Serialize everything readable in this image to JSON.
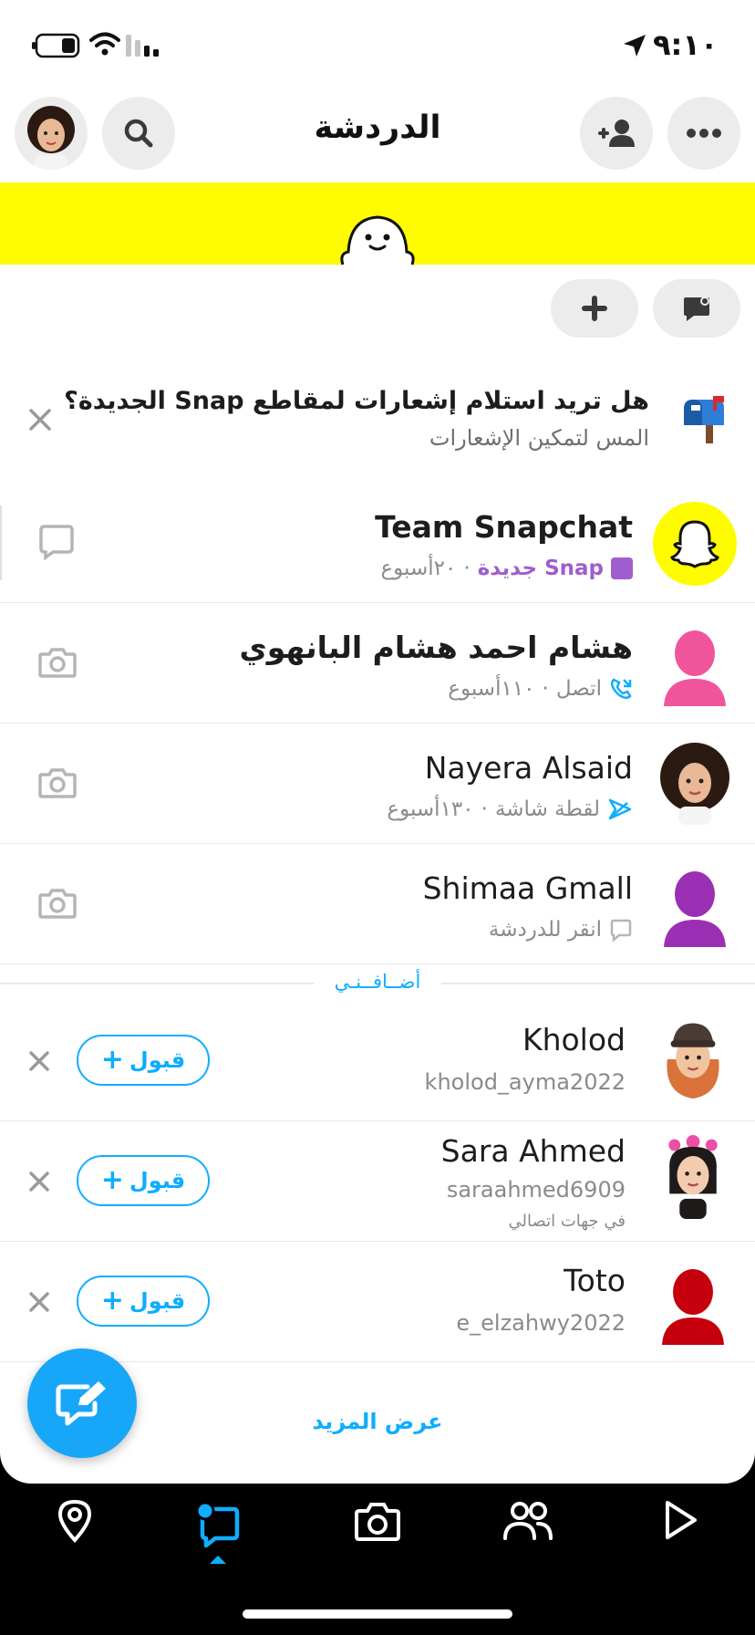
{
  "status_bar": {
    "time": "٩:١٠"
  },
  "header": {
    "title": "الدردشة"
  },
  "notification_prompt": {
    "title_before": "هل تريد استلام إشعارات لمقاطع",
    "title_brand": "Snap",
    "title_after": "الجديدة؟",
    "subtitle": "المس لتمكين الإشعارات"
  },
  "chats": [
    {
      "name": "Team Snapchat",
      "status_brand": "Snap",
      "status_text": "جديدة",
      "time": "٢٠أسبوع"
    },
    {
      "name": "هشام احمد هشام البانهوي",
      "status_text": "اتصل",
      "time": "١١٠أسبوع"
    },
    {
      "name": "Nayera Alsaid",
      "status_text": "لقطة شاشة",
      "time": "١٣٠أسبوع"
    },
    {
      "name": "Shimaa Gmall",
      "status_text": "انقر للدردشة"
    }
  ],
  "added_me": {
    "section_label": "أضــافــنـي",
    "accept_label": "قبول",
    "requests": [
      {
        "name": "Kholod",
        "username": "kholod_ayma2022",
        "note": ""
      },
      {
        "name": "Sara Ahmed",
        "username": "saraahmed6909",
        "note": "في جهات اتصالي"
      },
      {
        "name": "Toto",
        "username": "e_elzahwy2022",
        "note": ""
      }
    ],
    "show_more": "عرض المزيد"
  },
  "colors": {
    "snap_yellow": "#fffc00",
    "accent_blue": "#0fadff",
    "snap_purple": "#a05dcd",
    "bitmoji_pink": "#f0559b",
    "bitmoji_purple": "#9b2fb3",
    "bitmoji_red": "#c5000c"
  }
}
